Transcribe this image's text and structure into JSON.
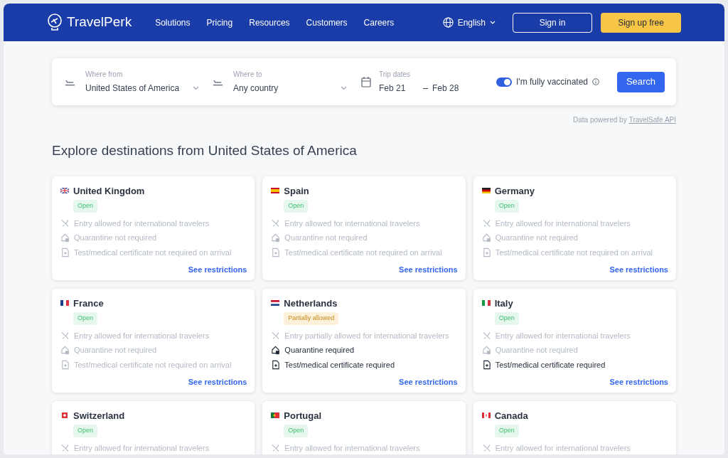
{
  "header": {
    "logo": "TravelPerk",
    "nav": [
      "Solutions",
      "Pricing",
      "Resources",
      "Customers",
      "Careers"
    ],
    "language": "English",
    "sign_in": "Sign in",
    "sign_up": "Sign up free"
  },
  "search": {
    "from": {
      "label": "Where from",
      "value": "United States of America"
    },
    "to": {
      "label": "Where to",
      "value": "Any country"
    },
    "dates": {
      "label": "Trip dates",
      "start": "Feb 21",
      "end": "Feb 28"
    },
    "vaccinated": {
      "label": "I'm fully vaccinated",
      "on": true
    },
    "button": "Search"
  },
  "powered": {
    "text": "Data powered by",
    "link": "TravelSafe API"
  },
  "heading": "Explore destinations from United States of America",
  "destinations": [
    {
      "name": "United Kingdom",
      "flag": {
        "kind": "gb"
      },
      "status": {
        "kind": "open",
        "label": "Open"
      },
      "requirements": [
        {
          "kind": "entry",
          "text": "Entry allowed for international travelers",
          "required": false
        },
        {
          "kind": "quarantine",
          "text": "Quarantine not required",
          "required": false
        },
        {
          "kind": "test",
          "text": "Test/medical certificate not required on arrival",
          "required": false
        }
      ],
      "link": "See restrictions"
    },
    {
      "name": "Spain",
      "flag": {
        "kind": "es"
      },
      "status": {
        "kind": "open",
        "label": "Open"
      },
      "requirements": [
        {
          "kind": "entry",
          "text": "Entry allowed for international travelers",
          "required": false
        },
        {
          "kind": "quarantine",
          "text": "Quarantine not required",
          "required": false
        },
        {
          "kind": "test",
          "text": "Test/medical certificate not required on arrival",
          "required": false
        }
      ],
      "link": "See restrictions"
    },
    {
      "name": "Germany",
      "flag": {
        "kind": "de"
      },
      "status": {
        "kind": "open",
        "label": "Open"
      },
      "requirements": [
        {
          "kind": "entry",
          "text": "Entry allowed for international travelers",
          "required": false
        },
        {
          "kind": "quarantine",
          "text": "Quarantine not required",
          "required": false
        },
        {
          "kind": "test",
          "text": "Test/medical certificate not required on arrival",
          "required": false
        }
      ],
      "link": "See restrictions"
    },
    {
      "name": "France",
      "flag": {
        "kind": "fr"
      },
      "status": {
        "kind": "open",
        "label": "Open"
      },
      "requirements": [
        {
          "kind": "entry",
          "text": "Entry allowed for international travelers",
          "required": false
        },
        {
          "kind": "quarantine",
          "text": "Quarantine not required",
          "required": false
        },
        {
          "kind": "test",
          "text": "Test/medical certificate not required on arrival",
          "required": false
        }
      ],
      "link": "See restrictions"
    },
    {
      "name": "Netherlands",
      "flag": {
        "kind": "nl"
      },
      "status": {
        "kind": "partial",
        "label": "Partially allowed"
      },
      "requirements": [
        {
          "kind": "entry",
          "text": "Entry partially allowed for international travelers",
          "required": false
        },
        {
          "kind": "quarantine",
          "text": "Quarantine required",
          "required": true
        },
        {
          "kind": "test",
          "text": "Test/medical certificate required",
          "required": true
        }
      ],
      "link": "See restrictions"
    },
    {
      "name": "Italy",
      "flag": {
        "kind": "it"
      },
      "status": {
        "kind": "open",
        "label": "Open"
      },
      "requirements": [
        {
          "kind": "entry",
          "text": "Entry allowed for international travelers",
          "required": false
        },
        {
          "kind": "quarantine",
          "text": "Quarantine not required",
          "required": false
        },
        {
          "kind": "test",
          "text": "Test/medical certificate required",
          "required": true
        }
      ],
      "link": "See restrictions"
    },
    {
      "name": "Switzerland",
      "flag": {
        "kind": "ch"
      },
      "status": {
        "kind": "open",
        "label": "Open"
      },
      "requirements": [
        {
          "kind": "entry",
          "text": "Entry allowed for international travelers",
          "required": false
        }
      ]
    },
    {
      "name": "Portugal",
      "flag": {
        "kind": "pt"
      },
      "status": {
        "kind": "open",
        "label": "Open"
      },
      "requirements": [
        {
          "kind": "entry",
          "text": "Entry allowed for international travelers",
          "required": false
        }
      ]
    },
    {
      "name": "Canada",
      "flag": {
        "kind": "ca"
      },
      "status": {
        "kind": "open",
        "label": "Open"
      },
      "requirements": [
        {
          "kind": "entry",
          "text": "Entry allowed for international travelers",
          "required": false
        }
      ]
    }
  ]
}
